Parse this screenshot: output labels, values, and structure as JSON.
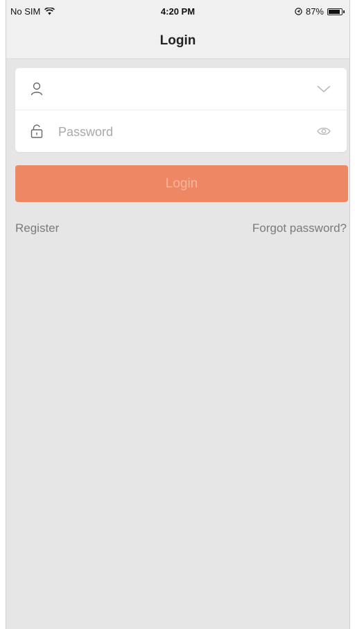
{
  "status_bar": {
    "carrier": "No SIM",
    "time": "4:20 PM",
    "battery_percent_text": "87%",
    "battery_level": 0.87
  },
  "nav": {
    "title": "Login"
  },
  "form": {
    "username": {
      "value": "",
      "placeholder": ""
    },
    "password": {
      "value": "",
      "placeholder": "Password"
    }
  },
  "login_button": {
    "label": "Login"
  },
  "links": {
    "register": "Register",
    "forgot": "Forgot password?"
  },
  "colors": {
    "accent": "#ee8763",
    "background": "#e6e6e6"
  },
  "icons": [
    "wifi-icon",
    "location-icon",
    "battery-icon",
    "user-icon",
    "chevron-down-icon",
    "lock-icon",
    "eye-icon"
  ]
}
